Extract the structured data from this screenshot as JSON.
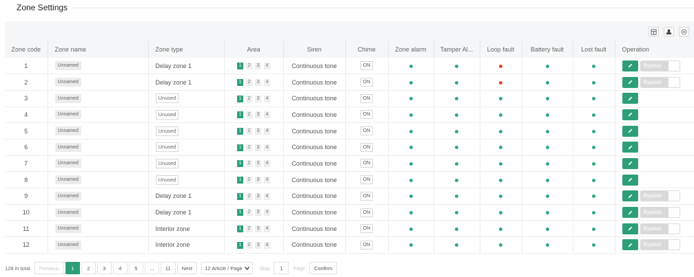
{
  "page": {
    "title": "Zone Settings"
  },
  "toolbar": {
    "icons": [
      "columns-icon",
      "export-icon",
      "print-icon"
    ]
  },
  "columns": [
    "Zone code",
    "Zone name",
    "Zone type",
    "Area",
    "Siren",
    "Chime",
    "Zone alarm",
    "Tamper Al...",
    "Loop fault",
    "Battery fault",
    "Lost fault",
    "Operation"
  ],
  "rows": [
    {
      "code": "1",
      "name": "Unnamed",
      "type": "Delay zone 1",
      "unused": false,
      "areas": [
        "1",
        "2",
        "3",
        "4"
      ],
      "siren": "Continuous tone",
      "chime": "ON",
      "loop_fault": "red",
      "bypass": "Bypass"
    },
    {
      "code": "2",
      "name": "Unnamed",
      "type": "Delay zone 1",
      "unused": false,
      "areas": [
        "1",
        "2",
        "3",
        "4"
      ],
      "siren": "Continuous tone",
      "chime": "ON",
      "loop_fault": "red",
      "bypass": "Bypass"
    },
    {
      "code": "3",
      "name": "Unnamed",
      "type": "Unused",
      "unused": true,
      "areas": [
        "1",
        "2",
        "3",
        "4"
      ],
      "siren": "Continuous tone",
      "chime": "ON",
      "loop_fault": "green",
      "bypass": ""
    },
    {
      "code": "4",
      "name": "Unnamed",
      "type": "Unused",
      "unused": true,
      "areas": [
        "1",
        "2",
        "3",
        "4"
      ],
      "siren": "Continuous tone",
      "chime": "ON",
      "loop_fault": "green",
      "bypass": ""
    },
    {
      "code": "5",
      "name": "Unnamed",
      "type": "Unused",
      "unused": true,
      "areas": [
        "1",
        "2",
        "3",
        "4"
      ],
      "siren": "Continuous tone",
      "chime": "ON",
      "loop_fault": "green",
      "bypass": ""
    },
    {
      "code": "6",
      "name": "Unnamed",
      "type": "Unused",
      "unused": true,
      "areas": [
        "1",
        "2",
        "3",
        "4"
      ],
      "siren": "Continuous tone",
      "chime": "ON",
      "loop_fault": "green",
      "bypass": ""
    },
    {
      "code": "7",
      "name": "Unnamed",
      "type": "Unused",
      "unused": true,
      "areas": [
        "1",
        "2",
        "3",
        "4"
      ],
      "siren": "Continuous tone",
      "chime": "ON",
      "loop_fault": "green",
      "bypass": ""
    },
    {
      "code": "8",
      "name": "Unnamed",
      "type": "Unused",
      "unused": true,
      "areas": [
        "1",
        "2",
        "3",
        "4"
      ],
      "siren": "Continuous tone",
      "chime": "ON",
      "loop_fault": "green",
      "bypass": ""
    },
    {
      "code": "9",
      "name": "Unnamed",
      "type": "Delay zone 1",
      "unused": false,
      "areas": [
        "1",
        "2",
        "3",
        "4"
      ],
      "siren": "Continuous tone",
      "chime": "ON",
      "loop_fault": "green",
      "bypass": "Bypass"
    },
    {
      "code": "10",
      "name": "Unnamed",
      "type": "Delay zone 1",
      "unused": false,
      "areas": [
        "1",
        "2",
        "3",
        "4"
      ],
      "siren": "Continuous tone",
      "chime": "ON",
      "loop_fault": "green",
      "bypass": "Bypass"
    },
    {
      "code": "11",
      "name": "Unnamed",
      "type": "Interior zone",
      "unused": false,
      "areas": [
        "1",
        "2",
        "3",
        "4"
      ],
      "siren": "Continuous tone",
      "chime": "ON",
      "loop_fault": "green",
      "bypass": "Bypass"
    },
    {
      "code": "12",
      "name": "Unnamed",
      "type": "Interior zone",
      "unused": false,
      "areas": [
        "1",
        "2",
        "3",
        "4"
      ],
      "siren": "Continuous tone",
      "chime": "ON",
      "loop_fault": "green",
      "bypass": "Bypass"
    }
  ],
  "status_colors": {
    "ok": "#2eaa7d",
    "fault": "#e8442f",
    "accent": "#2e9e79"
  },
  "pagination": {
    "total": "128 in total",
    "previous": "Previous",
    "pages": [
      "1",
      "2",
      "3",
      "4",
      "5",
      "...",
      "11"
    ],
    "current": "1",
    "next": "Next",
    "page_size": "12 Article / Page",
    "skip_label": "Skip",
    "skip_value": "1",
    "page_label": "Page",
    "confirm": "Confirm"
  }
}
